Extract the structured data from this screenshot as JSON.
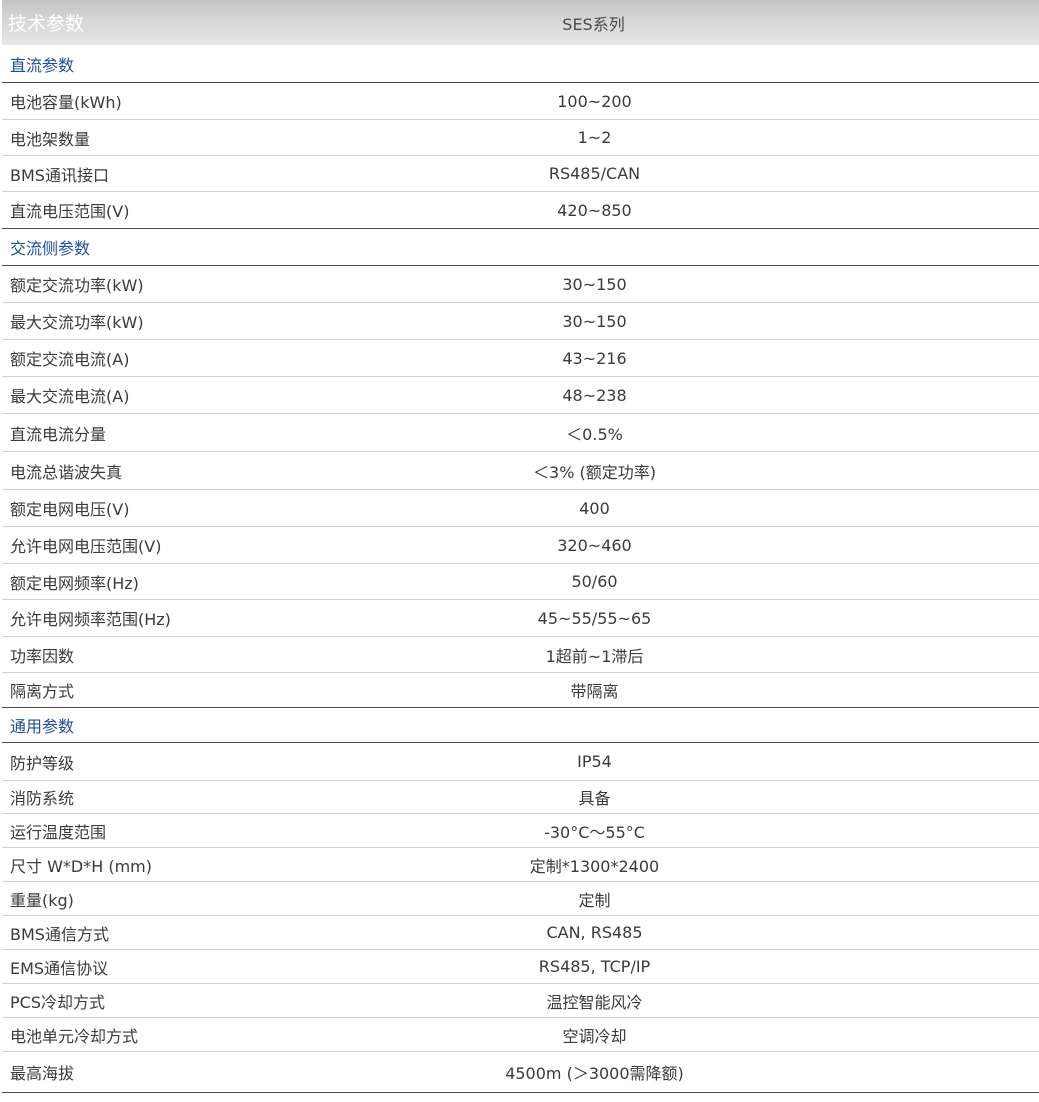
{
  "header": {
    "label": "技术参数",
    "value": "SES系列"
  },
  "sections": [
    {
      "title": "直流参数",
      "rows": [
        {
          "label": "电池容量(kWh)",
          "value": "100~200"
        },
        {
          "label": "电池架数量",
          "value": "1~2"
        },
        {
          "label": "BMS通讯接口",
          "value": "RS485/CAN"
        },
        {
          "label": "直流电压范围(V)",
          "value": "420~850"
        }
      ]
    },
    {
      "title": "交流侧参数",
      "rows": [
        {
          "label": "额定交流功率(kW)",
          "value": "30~150"
        },
        {
          "label": "最大交流功率(kW)",
          "value": "30~150"
        },
        {
          "label": "额定交流电流(A)",
          "value": "43~216"
        },
        {
          "label": "最大交流电流(A)",
          "value": "48~238"
        },
        {
          "label": "直流电流分量",
          "value": "＜0.5%"
        },
        {
          "label": "电流总谐波失真",
          "value": "＜3% (额定功率)"
        },
        {
          "label": "额定电网电压(V)",
          "value": "400"
        },
        {
          "label": "允许电网电压范围(V)",
          "value": "320~460"
        },
        {
          "label": "额定电网频率(Hz)",
          "value": "50/60"
        },
        {
          "label": "允许电网频率范围(Hz)",
          "value": "45~55/55~65"
        },
        {
          "label": "功率因数",
          "value": "1超前~1滞后"
        },
        {
          "label": "隔离方式",
          "value": "带隔离"
        }
      ]
    },
    {
      "title": "通用参数",
      "rows": [
        {
          "label": "防护等级",
          "value": "IP54"
        },
        {
          "label": "消防系统",
          "value": "具备"
        },
        {
          "label": "运行温度范围",
          "value": "-30°C～55°C"
        },
        {
          "label": "尺寸 W*D*H (mm)",
          "value": "定制*1300*2400"
        },
        {
          "label": "重量(kg)",
          "value": "定制"
        },
        {
          "label": "BMS通信方式",
          "value": "CAN, RS485"
        },
        {
          "label": "EMS通信协议",
          "value": "RS485, TCP/IP"
        },
        {
          "label": "PCS冷却方式",
          "value": "温控智能风冷"
        },
        {
          "label": "电池单元冷却方式",
          "value": "空调冷却"
        },
        {
          "label": "最高海拔",
          "value": "4500m (＞3000需降额)"
        }
      ]
    }
  ]
}
